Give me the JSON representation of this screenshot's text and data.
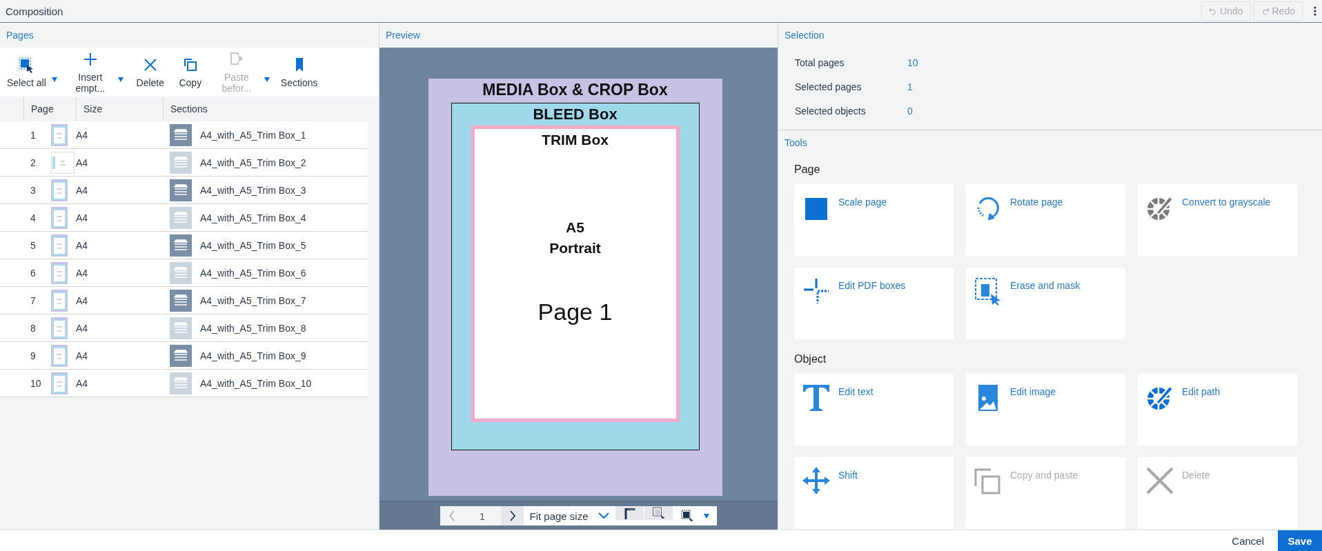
{
  "window": {
    "title": "Composition"
  },
  "history": [
    {
      "label": "Undo",
      "disabled": true
    },
    {
      "label": "Redo",
      "disabled": true
    }
  ],
  "pages_panel": {
    "title": "Pages",
    "toolbar": [
      {
        "label": "Select all",
        "disabled": false,
        "dropdown": true
      },
      {
        "label": "Insert empt...",
        "disabled": false,
        "dropdown": true
      },
      {
        "label": "Delete",
        "disabled": false,
        "dropdown": false
      },
      {
        "label": "Copy",
        "disabled": false,
        "dropdown": false
      },
      {
        "label": "Paste befor...",
        "disabled": true,
        "dropdown": true
      },
      {
        "label": "Sections",
        "disabled": false,
        "dropdown": false
      }
    ],
    "columns": [
      "Page",
      "Size",
      "Sections"
    ],
    "rows": [
      {
        "page": "1",
        "kind": "portrait",
        "size": "A4",
        "section": "A4_with_A5_Trim Box_1",
        "color": "#7a8ea6"
      },
      {
        "page": "2",
        "kind": "rotated",
        "size": "A4",
        "section": "A4_with_A5_Trim Box_2",
        "color": "#c9d4df"
      },
      {
        "page": "3",
        "kind": "portrait",
        "size": "A4",
        "section": "A4_with_A5_Trim Box_3",
        "color": "#7a8ea6"
      },
      {
        "page": "4",
        "kind": "portrait",
        "size": "A4",
        "section": "A4_with_A5_Trim Box_4",
        "color": "#c9d4df"
      },
      {
        "page": "5",
        "kind": "portrait",
        "size": "A4",
        "section": "A4_with_A5_Trim Box_5",
        "color": "#7a8ea6"
      },
      {
        "page": "6",
        "kind": "portrait",
        "size": "A4",
        "section": "A4_with_A5_Trim Box_6",
        "color": "#c9d4df"
      },
      {
        "page": "7",
        "kind": "portrait",
        "size": "A4",
        "section": "A4_with_A5_Trim Box_7",
        "color": "#7a8ea6"
      },
      {
        "page": "8",
        "kind": "portrait",
        "size": "A4",
        "section": "A4_with_A5_Trim Box_8",
        "color": "#c9d4df"
      },
      {
        "page": "9",
        "kind": "portrait",
        "size": "A4",
        "section": "A4_with_A5_Trim Box_9",
        "color": "#7a8ea6"
      },
      {
        "page": "10",
        "kind": "portrait",
        "size": "A4",
        "section": "A4_with_A5_Trim Box_10",
        "color": "#c9d4df"
      }
    ]
  },
  "preview": {
    "title": "Preview",
    "document": {
      "media_label": "MEDIA Box & CROP Box",
      "bleed_label": "BLEED Box",
      "trim_label": "TRIM Box",
      "format_lines": [
        "A5",
        "Portrait"
      ],
      "page_label": "Page 1"
    },
    "page_field": "1",
    "zoom_select": "Fit page size"
  },
  "selection": {
    "title": "Selection",
    "stats": [
      {
        "label": "Total pages",
        "value": "10"
      },
      {
        "label": "Selected pages",
        "value": "1"
      },
      {
        "label": "Selected objects",
        "value": "0"
      }
    ]
  },
  "tools": {
    "title": "Tools",
    "groups": [
      {
        "title": "Page",
        "items": [
          {
            "label": "Scale page",
            "disabled": false
          },
          {
            "label": "Rotate page",
            "disabled": false
          },
          {
            "label": "Convert to grayscale",
            "disabled": false
          },
          {
            "label": "Edit PDF boxes",
            "disabled": false
          },
          {
            "label": "Erase and mask",
            "disabled": false
          }
        ]
      },
      {
        "title": "Object",
        "items": [
          {
            "label": "Edit text",
            "disabled": false
          },
          {
            "label": "Edit image",
            "disabled": false
          },
          {
            "label": "Edit path",
            "disabled": false
          },
          {
            "label": "Shift",
            "disabled": false
          },
          {
            "label": "Copy and paste",
            "disabled": true
          },
          {
            "label": "Delete",
            "disabled": true
          }
        ]
      }
    ]
  },
  "footer": {
    "cancel": "Cancel",
    "save": "Save"
  }
}
